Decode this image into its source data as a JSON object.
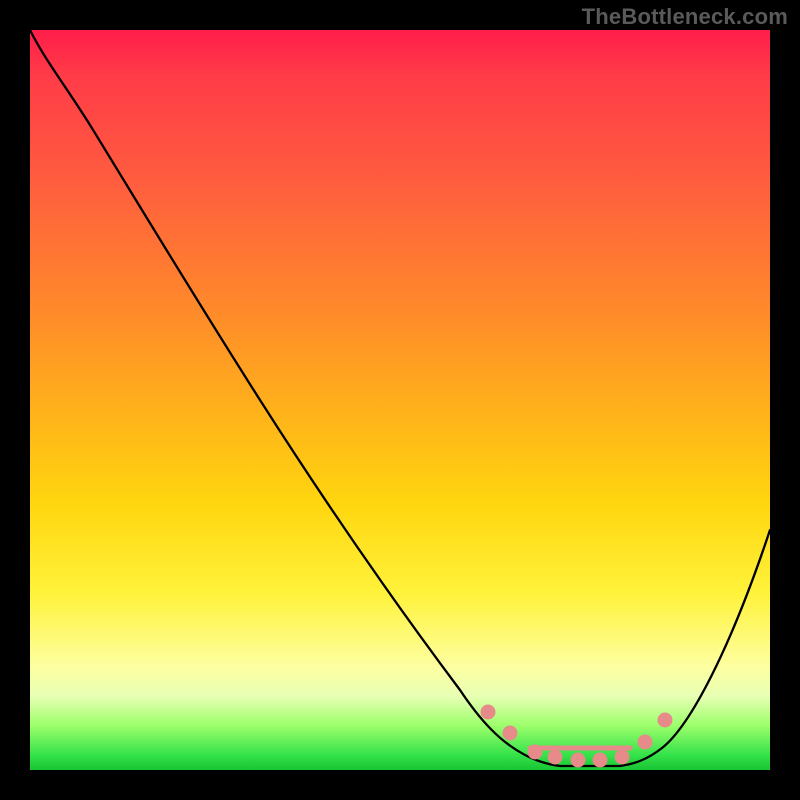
{
  "watermark": "TheBottleneck.com",
  "chart_data": {
    "type": "line",
    "title": "",
    "xlabel": "",
    "ylabel": "",
    "xlim": [
      0,
      100
    ],
    "ylim": [
      0,
      100
    ],
    "grid": false,
    "legend": false,
    "series": [
      {
        "name": "curve",
        "x": [
          0,
          4,
          10,
          20,
          30,
          40,
          50,
          58,
          62,
          66,
          70,
          74,
          78,
          82,
          86,
          90,
          94,
          100
        ],
        "y": [
          100,
          97,
          89,
          75,
          60,
          45,
          31,
          18,
          12,
          7,
          3,
          1,
          0,
          0,
          1,
          3,
          10,
          32
        ],
        "color": "#000000"
      }
    ],
    "markers": {
      "name": "valley-dots",
      "x": [
        62,
        65,
        68,
        71,
        74,
        77,
        80,
        83,
        86
      ],
      "y": [
        8,
        5,
        3,
        1.5,
        0.5,
        0.5,
        1,
        3,
        8
      ],
      "color": "#e78a8a"
    },
    "gradient_stops": [
      {
        "pos": 0,
        "color": "#ff1d4a"
      },
      {
        "pos": 20,
        "color": "#ff5c3f"
      },
      {
        "pos": 50,
        "color": "#ffb31a"
      },
      {
        "pos": 76,
        "color": "#fff23a"
      },
      {
        "pos": 90,
        "color": "#e8ffb4"
      },
      {
        "pos": 100,
        "color": "#17c433"
      }
    ]
  }
}
